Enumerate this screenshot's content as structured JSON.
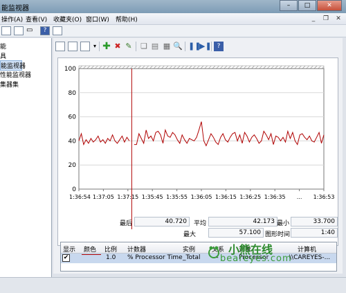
{
  "window": {
    "title": "能监视器"
  },
  "menu": {
    "items": [
      "操作(A)",
      "查看(V)",
      "收藏夹(O)",
      "窗口(W)",
      "帮助(H)"
    ]
  },
  "tree": {
    "items": [
      "能",
      "具",
      "能监视器",
      "性能监视器",
      "集器集"
    ],
    "selected_index": 2
  },
  "stats": {
    "last_label": "最后",
    "last_value": "40.720",
    "avg_label": "平均",
    "avg_value": "42.173",
    "min_label": "最小",
    "min_value": "33.700",
    "max_label": "最大",
    "max_value": "57.100",
    "duration_label": "图形时间",
    "duration_value": "1:40"
  },
  "counters": {
    "headers": [
      "显示",
      "颜色",
      "比例",
      "计数器",
      "实例",
      "父系",
      "对象",
      "计算机"
    ],
    "rows": [
      {
        "show": "✔",
        "color": "#b00000",
        "scale": "1.0",
        "counter": "% Processor Time",
        "instance": "_Total",
        "parent": "---",
        "object": "Processor",
        "computer": "\\\\CAREYES-..."
      }
    ]
  },
  "watermark": {
    "line1": "小熊在线",
    "line2": "beareyes.com"
  },
  "chart_data": {
    "type": "line",
    "ylim": [
      0,
      100
    ],
    "yticks": [
      "100",
      "80",
      "60",
      "40",
      "20",
      "0"
    ],
    "xticks": [
      "1:36:54",
      "1:37:05",
      "1:37:15",
      "1:35:45",
      "1:35:55",
      "1:36:05",
      "1:36:15",
      "1:36:25",
      "1:36:35",
      "...",
      "1:36:53"
    ],
    "series": [
      {
        "color": "#b00000",
        "values": [
          40,
          46,
          37,
          41,
          38,
          42,
          39,
          41,
          44,
          39,
          41,
          38,
          42,
          40,
          45,
          40,
          38,
          41,
          44,
          39,
          43,
          40,
          null,
          37,
          37,
          46,
          42,
          38,
          49,
          42,
          44,
          40,
          47,
          48,
          45,
          38,
          49,
          44,
          43,
          47,
          45,
          41,
          38,
          45,
          41,
          38,
          42,
          41,
          40,
          43,
          49,
          56,
          40,
          36,
          41,
          46,
          43,
          39,
          37,
          43,
          46,
          41,
          39,
          43,
          46,
          47,
          40,
          45,
          38,
          47,
          44,
          39,
          43,
          45,
          42,
          38,
          40,
          48,
          45,
          41,
          46,
          37,
          44,
          43,
          40,
          43,
          39,
          48,
          42,
          47,
          40,
          37,
          45,
          46,
          43,
          41,
          44,
          40,
          39,
          43,
          47,
          38,
          45
        ]
      }
    ],
    "gap_start_index": 22
  }
}
